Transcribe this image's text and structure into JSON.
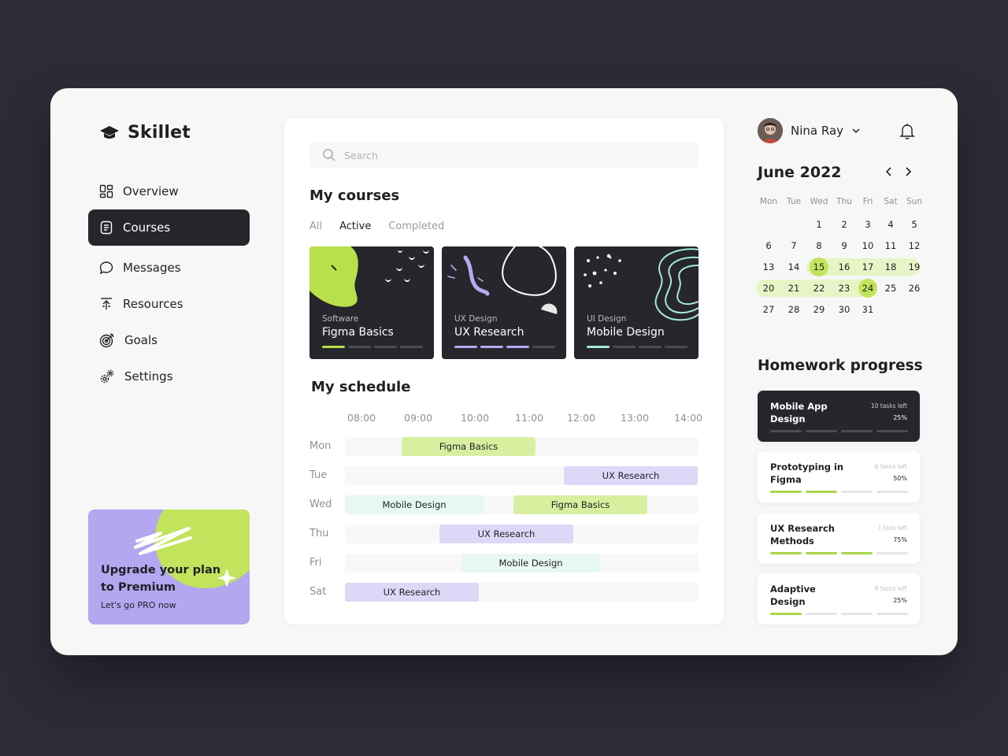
{
  "brand": {
    "name": "Skillet"
  },
  "nav": [
    {
      "label": "Overview",
      "icon": "dashboard-icon"
    },
    {
      "label": "Courses",
      "icon": "document-icon",
      "active": true
    },
    {
      "label": "Messages",
      "icon": "chat-icon"
    },
    {
      "label": "Resources",
      "icon": "upload-icon"
    },
    {
      "label": "Goals",
      "icon": "target-icon"
    },
    {
      "label": "Settings",
      "icon": "gears-icon"
    }
  ],
  "promo": {
    "title": "Upgrade your plan to Premium",
    "subtitle": "Let's go PRO now"
  },
  "search": {
    "placeholder": "Search"
  },
  "courses": {
    "title": "My courses",
    "tabs": [
      "All",
      "Active",
      "Completed"
    ],
    "active_tab": "Active",
    "cards": [
      {
        "category": "Software",
        "title": "Figma Basics",
        "progress_segments": 1,
        "total_segments": 4,
        "accent": "#b8e04a"
      },
      {
        "category": "UX Design",
        "title": "UX Research",
        "progress_segments": 3,
        "total_segments": 4,
        "accent": "#b7a8f0"
      },
      {
        "category": "UI Design",
        "title": "Mobile Design",
        "progress_segments": 1,
        "total_segments": 4,
        "accent": "#a6e9d6"
      }
    ]
  },
  "schedule": {
    "title": "My schedule",
    "times": [
      "08:00",
      "09:00",
      "10:00",
      "11:00",
      "12:00",
      "13:00",
      "14:00"
    ],
    "rows": [
      {
        "day": "Mon",
        "events": [
          {
            "label": "Figma Basics",
            "start": "08:45",
            "end": "11:15",
            "color": "green"
          }
        ]
      },
      {
        "day": "Tue",
        "events": [
          {
            "label": "UX Research",
            "start": "12:00",
            "end": "14:30",
            "color": "purple"
          }
        ]
      },
      {
        "day": "Wed",
        "events": [
          {
            "label": "Mobile Design",
            "start": "08:00",
            "end": "10:30",
            "color": "mint"
          },
          {
            "label": "Figma Basics",
            "start": "11:00",
            "end": "13:30",
            "color": "green"
          }
        ]
      },
      {
        "day": "Thu",
        "events": [
          {
            "label": "UX Research",
            "start": "09:30",
            "end": "12:00",
            "color": "purple"
          }
        ]
      },
      {
        "day": "Fri",
        "events": [
          {
            "label": "Mobile Design",
            "start": "10:00",
            "end": "12:45",
            "color": "mint"
          }
        ]
      },
      {
        "day": "Sat",
        "events": [
          {
            "label": "UX Research",
            "start": "08:00",
            "end": "10:30",
            "color": "purple"
          }
        ]
      }
    ]
  },
  "user": {
    "name": "Nina Ray"
  },
  "calendar": {
    "month": "June",
    "year": "2022",
    "weekdays": [
      "Mon",
      "Tue",
      "Wed",
      "Thu",
      "Fri",
      "Sat",
      "Sun"
    ],
    "first_weekday_index": 2,
    "days_in_month": 30,
    "extra_day": "31",
    "selected": [
      15,
      24
    ],
    "highlight_range": [
      15,
      24
    ]
  },
  "homework": {
    "title": "Homework progress",
    "items": [
      {
        "name": "Mobile App Design",
        "tasks_left": "10 tasks left",
        "percent": "25%",
        "progress_segments": 1,
        "dark": true
      },
      {
        "name": "Prototyping in Figma",
        "tasks_left": "6 tasks left",
        "percent": "50%",
        "progress_segments": 2,
        "dark": false
      },
      {
        "name": "UX Research Methods",
        "tasks_left": "1 task left",
        "percent": "75%",
        "progress_segments": 3,
        "dark": false
      },
      {
        "name": "Adaptive Design",
        "tasks_left": "8 tasks left",
        "percent": "25%",
        "progress_segments": 1,
        "dark": false
      }
    ]
  },
  "colors": {
    "accent_green": "#c2e45c",
    "accent_purple": "#b2a7f0",
    "dark": "#26262c"
  }
}
